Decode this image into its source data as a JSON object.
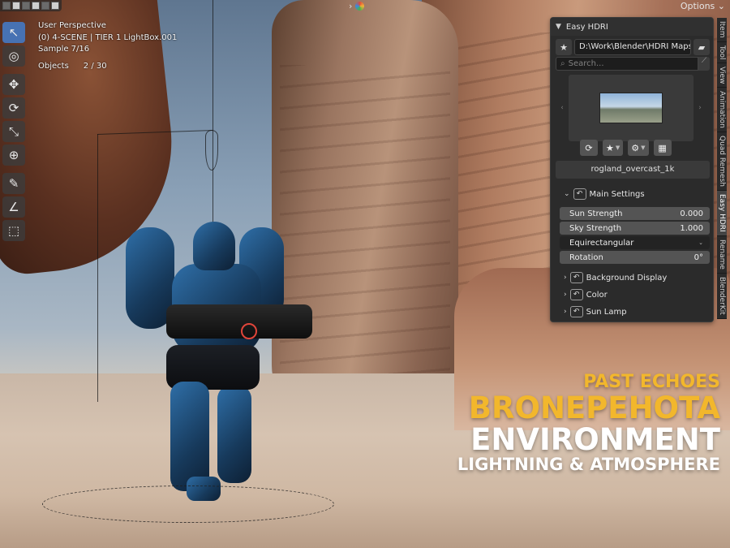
{
  "topbar": {
    "options_label": "Options",
    "chevron": "›"
  },
  "viewport_overlay": {
    "perspective": "User Perspective",
    "collection": "(0) 4-SCENE | TIER 1 LightBox.001",
    "sample": "Sample 7/16",
    "objects_label": "Objects",
    "objects_count": "2 / 30"
  },
  "toolbar": {
    "tools": [
      {
        "name": "select-tool-icon",
        "glyph": "↖",
        "active": true
      },
      {
        "name": "cursor-tool-icon",
        "glyph": "◎",
        "active": false
      },
      {
        "name": "move-tool-icon",
        "glyph": "✥",
        "active": false
      },
      {
        "name": "rotate-tool-icon",
        "glyph": "⟳",
        "active": false
      },
      {
        "name": "scale-tool-icon",
        "glyph": "⤡",
        "active": false
      },
      {
        "name": "transform-tool-icon",
        "glyph": "⊕",
        "active": false
      },
      {
        "name": "annotate-tool-icon",
        "glyph": "✎",
        "active": false
      },
      {
        "name": "measure-tool-icon",
        "glyph": "∠",
        "active": false
      },
      {
        "name": "add-cube-tool-icon",
        "glyph": "⬚",
        "active": false
      }
    ]
  },
  "panel": {
    "title": "Easy HDRI",
    "path": "D:\\Work\\Blender\\HDRI Maps\\",
    "search_placeholder": "Search...",
    "hdri_name": "rogland_overcast_1k",
    "main_settings": {
      "label": "Main Settings",
      "sun_strength_label": "Sun Strength",
      "sun_strength_value": "0.000",
      "sky_strength_label": "Sky Strength",
      "sky_strength_value": "1.000",
      "projection": "Equirectangular",
      "rotation_label": "Rotation",
      "rotation_value": "0°"
    },
    "sections": [
      "Background Display",
      "Color",
      "Sun Lamp"
    ]
  },
  "tabs": [
    "Item",
    "Tool",
    "View",
    "Animation",
    "Quad Remesh",
    "Easy HDRI",
    "Rename",
    "BlenderKit"
  ],
  "active_tab": "Easy HDRI",
  "promo": {
    "line1": "PAST ECHOES",
    "line2": "BRONEPEHOTA",
    "line3": "ENVIRONMENT",
    "line4": "LIGHTNING & ATMOSPHERE"
  },
  "colors": {
    "accent": "#4772b3",
    "promo_yellow": "#f2b72c",
    "panel_bg": "#2b2b2b"
  }
}
